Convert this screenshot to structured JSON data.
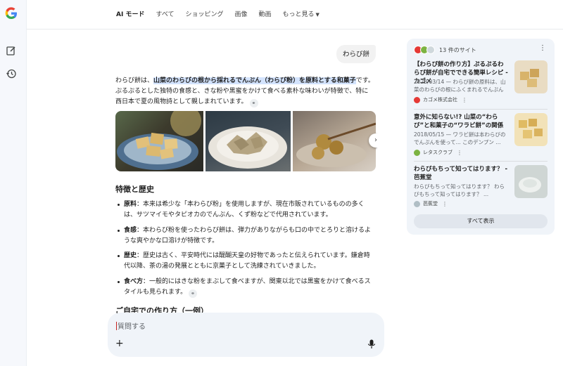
{
  "nav": {
    "tabs": [
      "AI モード",
      "すべて",
      "ショッピング",
      "画像",
      "動画",
      "もっと見る"
    ]
  },
  "query": "わらび餅",
  "answer": {
    "intro_prefix": "わらび餅は、",
    "intro_highlight": "山菜のわらびの根から採れるでんぷん（わらび粉）を原料とする和菓子",
    "intro_suffix": "です。ぷるぷるとした独特の食感と、きな粉や黒蜜をかけて食べる素朴な味わいが特徴で、特に西日本で夏の風物詩として親しまれています。",
    "section_title": "特徴と歴史",
    "bullets": [
      {
        "term": "原料",
        "text": "：本来は希少な「本わらび粉」を使用しますが、現在市販されているものの多くは、サツマイモやタピオカのでんぷん、くず粉などで代用されています。"
      },
      {
        "term": "食感",
        "text": "：本わらび粉を使ったわらび餅は、弾力がありながらも口の中でとろりと溶けるような爽やかな口溶けが特徴です。"
      },
      {
        "term": "歴史",
        "text": "：歴史は古く、平安時代には醍醐天皇の好物であったと伝えられています。鎌倉時代以降、茶の湯の発展とともに京菓子として洗練されていきました。"
      },
      {
        "term": "食べ方",
        "text": "：一般的にはきな粉をまぶして食べますが、関東以北では黒蜜をかけて食べるスタイルも見られます。"
      }
    ],
    "section2_title": "ご自宅での作り方（一例）"
  },
  "composer": {
    "placeholder": "質問する"
  },
  "sources": {
    "count_label": "13 件のサイト",
    "show_all": "すべて表示",
    "cards": [
      {
        "title": "【わらび餅の作り方】ぷるぷるわらび餅が自宅でできる簡単レシピ - カゴメ",
        "snippet": "2023/03/14 — わらび餅の原料は、山菜のわらびの根にふくまれるでんぷん ...",
        "source": "カゴメ株式会社"
      },
      {
        "title": "意外に知らない!? 山菜の“わらび”と和菓子の“ワラビ餅”の関係",
        "snippet": "2018/05/15 — ワラビ餅は本わらびのでんぷんを使って... このデンプン ...",
        "source": "レタスクラブ"
      },
      {
        "title": "わらびもちって知ってはります？ - 芭蕉堂",
        "snippet": "わらびもちって知ってはります？ わらびもちって知ってはります？ ...",
        "source": "芭蕉堂"
      }
    ]
  },
  "colors": {
    "highlight": "#d3e3fd",
    "panel_bg": "#f0f4f9",
    "accent": "#1a73e8"
  }
}
